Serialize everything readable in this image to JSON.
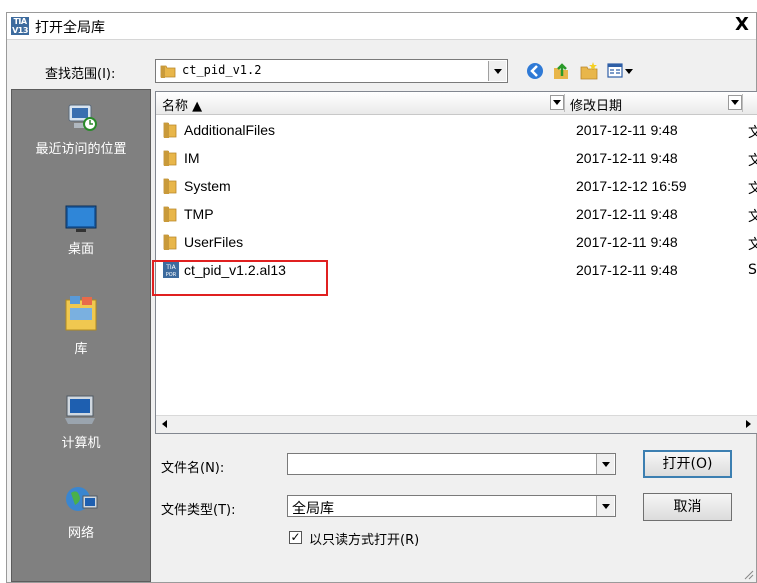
{
  "window": {
    "title": "打开全局库",
    "app_icon_text": "TIA\nV13",
    "close_label": "X"
  },
  "lookin": {
    "label": "查找范围(I):",
    "value": "ct_pid_v1.2"
  },
  "places": [
    {
      "label": "最近访问的位置",
      "icon": "recent-places-icon"
    },
    {
      "label": "桌面",
      "icon": "desktop-icon"
    },
    {
      "label": "库",
      "icon": "libraries-icon"
    },
    {
      "label": "计算机",
      "icon": "computer-icon"
    },
    {
      "label": "网络",
      "icon": "network-icon"
    }
  ],
  "columns": {
    "name": "名称",
    "date": "修改日期"
  },
  "files": [
    {
      "name": "AdditionalFiles",
      "date": "2017-12-11 9:48",
      "extra": "文",
      "type": "folder"
    },
    {
      "name": "IM",
      "date": "2017-12-11 9:48",
      "extra": "文",
      "type": "folder"
    },
    {
      "name": "System",
      "date": "2017-12-12 16:59",
      "extra": "文",
      "type": "folder"
    },
    {
      "name": "TMP",
      "date": "2017-12-11 9:48",
      "extra": "文",
      "type": "folder"
    },
    {
      "name": "UserFiles",
      "date": "2017-12-11 9:48",
      "extra": "文",
      "type": "folder"
    },
    {
      "name": "ct_pid_v1.2.al13",
      "date": "2017-12-11 9:48",
      "extra": "S",
      "type": "library-file"
    }
  ],
  "filename": {
    "label": "文件名(N):",
    "value": ""
  },
  "filetype": {
    "label": "文件类型(T):",
    "value": "全局库"
  },
  "readonly": {
    "label": "以只读方式打开(R)",
    "checked": true,
    "mark": "✓"
  },
  "buttons": {
    "open": "打开(O)",
    "cancel": "取消"
  },
  "colors": {
    "highlight": "#e02020",
    "folder": "#e8b64a",
    "places_bg": "#808080"
  }
}
